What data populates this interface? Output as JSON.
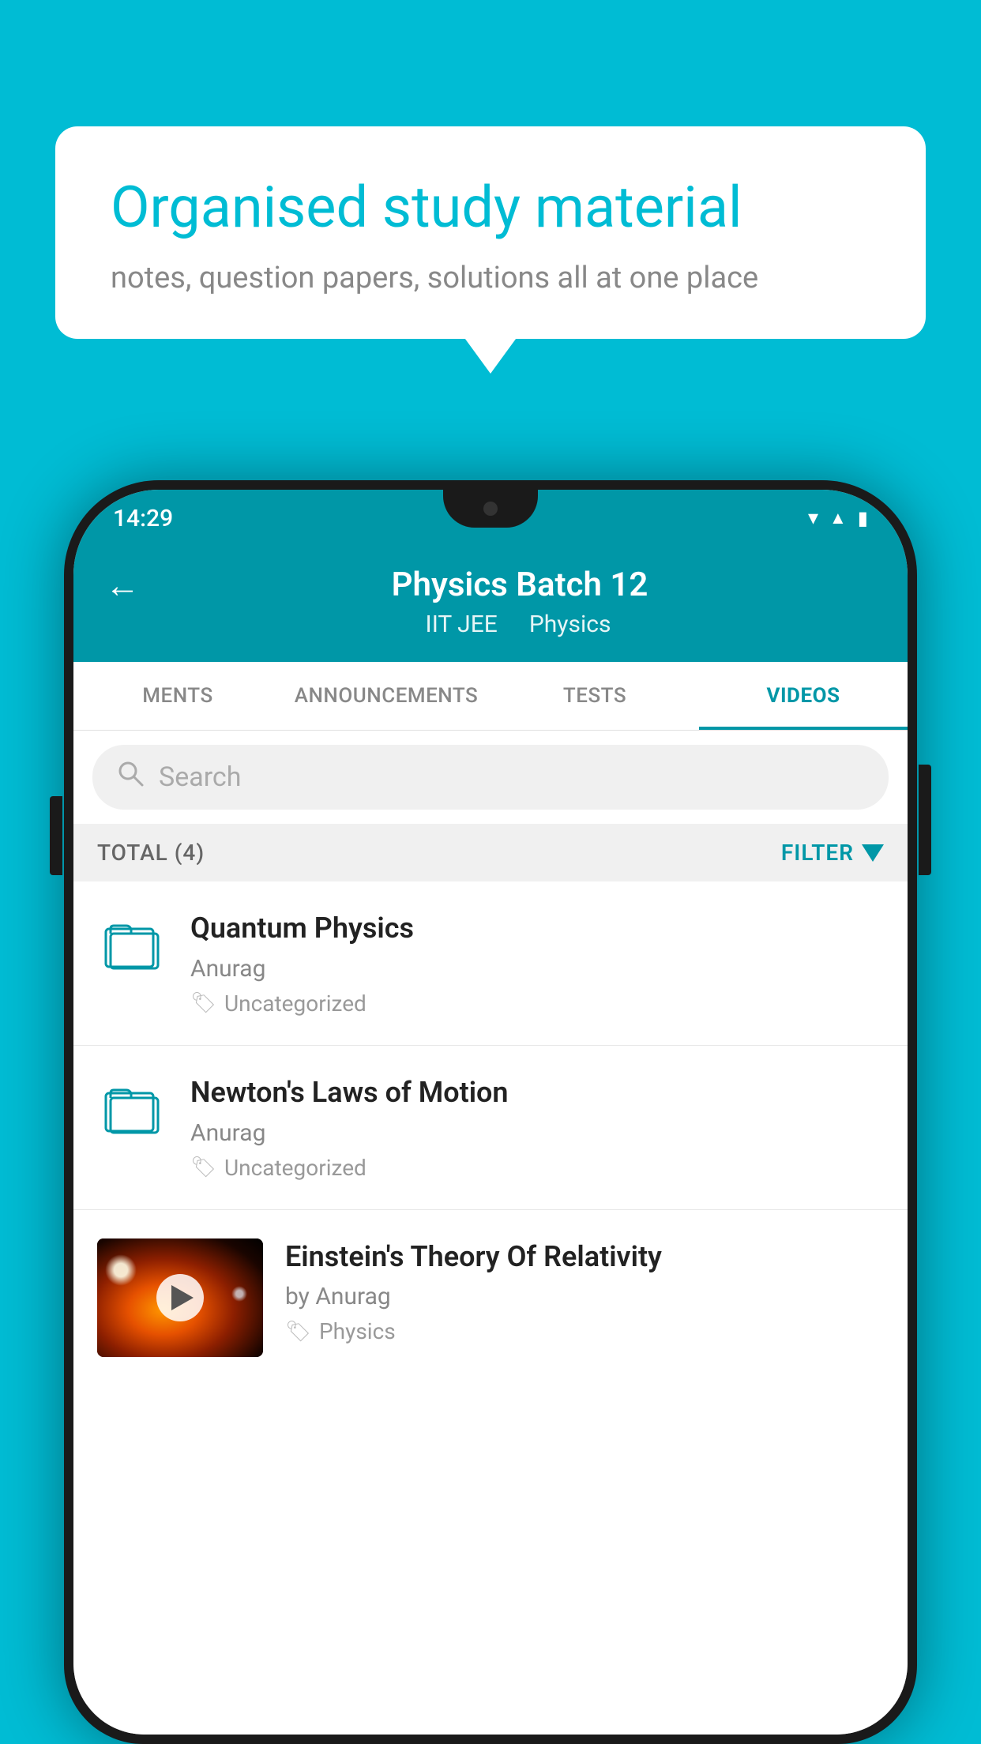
{
  "background": {
    "color": "#00bcd4"
  },
  "speech_bubble": {
    "title": "Organised study material",
    "subtitle": "notes, question papers, solutions all at one place"
  },
  "status_bar": {
    "time": "14:29",
    "wifi": "▾",
    "signal": "▲",
    "battery": "▮"
  },
  "app_bar": {
    "title": "Physics Batch 12",
    "subtitle_tags": [
      "IIT JEE",
      "Physics"
    ],
    "back_label": "←"
  },
  "tabs": [
    {
      "label": "MENTS",
      "active": false
    },
    {
      "label": "ANNOUNCEMENTS",
      "active": false
    },
    {
      "label": "TESTS",
      "active": false
    },
    {
      "label": "VIDEOS",
      "active": true
    }
  ],
  "search": {
    "placeholder": "Search"
  },
  "filter_bar": {
    "total_label": "TOTAL (4)",
    "filter_label": "FILTER"
  },
  "videos": [
    {
      "id": 1,
      "title": "Quantum Physics",
      "author": "Anurag",
      "tag": "Uncategorized",
      "has_thumbnail": false
    },
    {
      "id": 2,
      "title": "Newton's Laws of Motion",
      "author": "Anurag",
      "tag": "Uncategorized",
      "has_thumbnail": false
    },
    {
      "id": 3,
      "title": "Einstein's Theory Of Relativity",
      "author": "by Anurag",
      "tag": "Physics",
      "has_thumbnail": true
    }
  ]
}
